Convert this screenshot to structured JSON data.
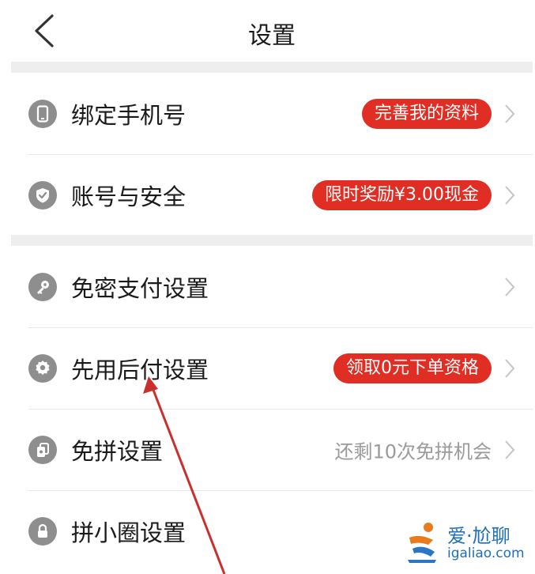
{
  "header": {
    "title": "设置",
    "back_icon": "chevron-left-icon"
  },
  "settings": {
    "group1": [
      {
        "label": "绑定手机号",
        "icon": "phone-icon",
        "badge": "完善我的资料"
      },
      {
        "label": "账号与安全",
        "icon": "shield-icon",
        "badge": "限时奖励¥3.00现金"
      }
    ],
    "group2": [
      {
        "label": "免密支付设置",
        "icon": "key-icon"
      },
      {
        "label": "先用后付设置",
        "icon": "gear-badge-icon",
        "badge": "领取0元下单资格"
      },
      {
        "label": "免拼设置",
        "icon": "card-stack-icon",
        "hint": "还剩10次免拼机会"
      },
      {
        "label": "拼小圈设置",
        "icon": "lock-icon"
      }
    ]
  },
  "colors": {
    "badge": "#e02e24",
    "icon": "#8e8e8e",
    "divider": "#eeeeee",
    "annotation_arrow": "#c9302c",
    "watermark": "#1f6fb8"
  },
  "watermark": {
    "brand": "爱·尬聊",
    "url": "igaliao.com"
  }
}
